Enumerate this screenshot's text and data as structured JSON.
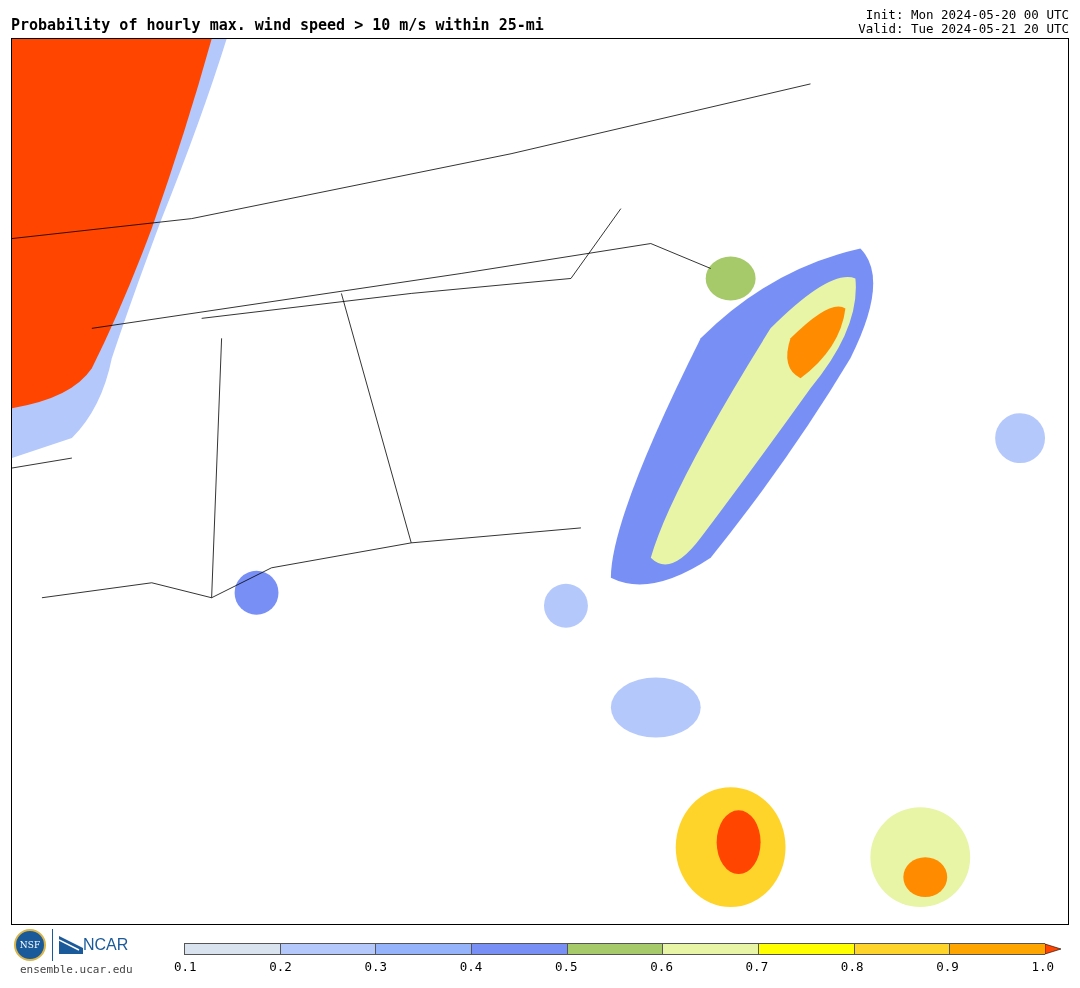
{
  "title": "Probability of hourly max. wind speed > 10 m/s within 25-mi",
  "init": "Init: Mon 2024-05-20 00 UTC",
  "valid": "Valid: Tue 2024-05-21 20 UTC",
  "logos": {
    "nsf": "NSF",
    "ncar": "NCAR",
    "url": "ensemble.ucar.edu"
  },
  "colorbar": {
    "segments": [
      {
        "color": "#d9e3ef"
      },
      {
        "color": "#b4c8fb"
      },
      {
        "color": "#94b3fb"
      },
      {
        "color": "#7890f5"
      },
      {
        "color": "#a6c96a"
      },
      {
        "color": "#e8f5a6"
      },
      {
        "color": "#ffff00"
      },
      {
        "color": "#ffd42a"
      },
      {
        "color": "#ffa500"
      },
      {
        "kind": "arrow",
        "color": "#ff4500"
      }
    ],
    "ticks": [
      "0.1",
      "0.2",
      "0.3",
      "0.4",
      "0.5",
      "0.6",
      "0.7",
      "0.8",
      "0.9",
      "1.0"
    ]
  }
}
